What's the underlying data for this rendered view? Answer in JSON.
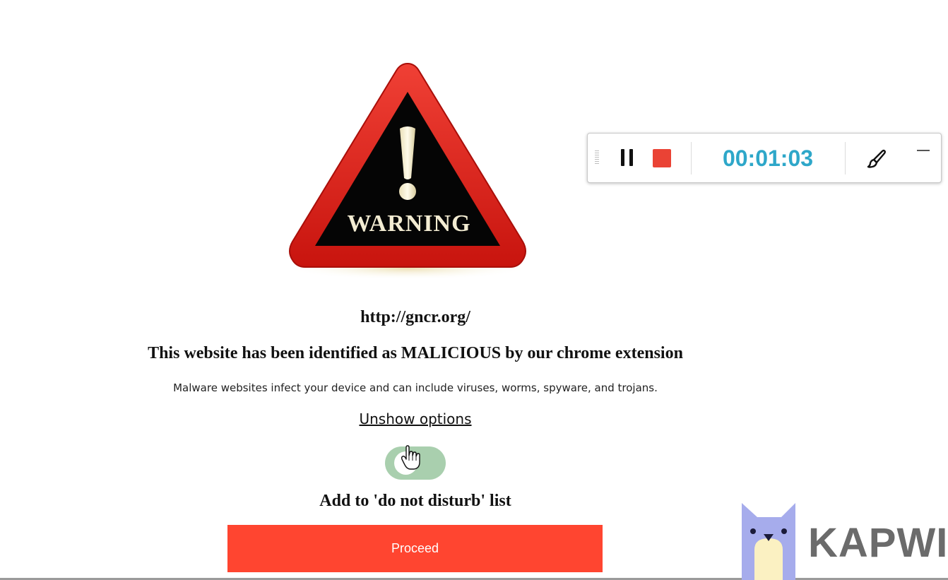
{
  "warning_graphic": {
    "text": "WARNING",
    "colors": {
      "outer": "#e0241b",
      "inner": "#000000",
      "exclamation": "#f3ecd2"
    }
  },
  "page": {
    "url": "http://gncr.org/",
    "headline": "This website has been identified as MALICIOUS by our chrome extension",
    "subtext": "Malware websites infect your device and can include viruses, worms, spyware, and trojans.",
    "unshow_link": "Unshow options",
    "toggle": {
      "state": "on",
      "color": "#a9cfae"
    },
    "dnd_label": "Add to 'do not disturb' list",
    "proceed_label": "Proceed",
    "proceed_color": "#ff4530"
  },
  "recorder": {
    "time": "00:01:03",
    "time_color": "#2ea7c9",
    "stop_color": "#ea4335",
    "icons": [
      "drag-grip-icon",
      "pause-icon",
      "stop-icon",
      "brush-icon",
      "minimize-icon"
    ]
  },
  "watermark": {
    "text": "KAPWI",
    "mascot_color": "#a6acec"
  }
}
